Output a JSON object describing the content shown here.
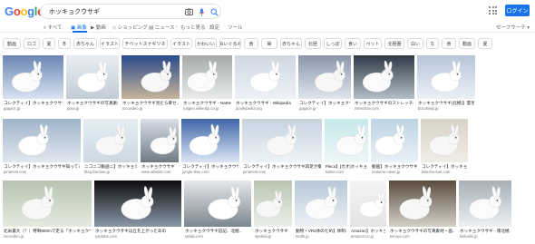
{
  "logo": {
    "text": "Google",
    "colors": [
      "#4285F4",
      "#EA4335",
      "#FBBC05",
      "#4285F4",
      "#34A853",
      "#EA4335"
    ]
  },
  "search": {
    "value": "ホッキョクウサギ"
  },
  "header": {
    "login_label": "ログイン"
  },
  "tabs": [
    {
      "label": "すべて",
      "icon": "search-icon"
    },
    {
      "label": "画像",
      "icon": "image-icon",
      "active": true
    },
    {
      "label": "動画",
      "icon": "video-icon"
    },
    {
      "label": "ショッピング",
      "icon": "shopping-icon"
    },
    {
      "label": "ニュース",
      "icon": "news-icon"
    },
    {
      "label": "もっと見る",
      "icon": "more-icon"
    },
    {
      "label": "設定",
      "icon": ""
    },
    {
      "label": "ツール",
      "icon": ""
    }
  ],
  "safesearch": {
    "label": "セーフサーチ ▾"
  },
  "chips": [
    "動画",
    "ロゴ",
    "夏",
    "冬",
    "赤ちゃん",
    "イラスト",
    "チベットスナギツネ",
    "イラスト",
    "かわいい",
    "ぬいぐるみ",
    "食",
    "巣",
    "赤ちゃん",
    "北極",
    "しっぽ",
    "食い",
    "ペット",
    "北極圏",
    "白い",
    "な",
    "食",
    "動画",
    "夏"
  ],
  "rows": [
    [
      {
        "caption": "コレクティイ】ホッキョクウサギ知ってる",
        "source": "gagace.jp"
      },
      {
        "caption": "ホッキョクウサギの写真素材・画",
        "source": "pixta.jp"
      },
      {
        "caption": "ホッキョクウサギ見たら幸せ..",
        "source": "nicovideo.jp"
      },
      {
        "caption": "ホッキョクウサギ - NatHeg..",
        "source": "natgeo.nikkeibp.co.jp"
      },
      {
        "caption": "ホッキョクウサギ - Wikipedia",
        "source": "ja.wikipedia.org"
      },
      {
        "caption": "コレクティイ】ホッキョクウサギ..",
        "source": "gagace.jp"
      },
      {
        "caption": "ホッキョクウサギのストレッチ、うさぎ最高",
        "source": "mimichan.com"
      },
      {
        "caption": "ホッキョクウサギ(北極)】夏毛に大人の..",
        "source": "bucchiwiji.jp"
      }
    ],
    [
      {
        "caption": "コレクティイ】ホッキョクウサギ知ってる",
        "source": "pinterest.com"
      },
      {
        "caption": "ニコニコ動画ニ】ホッキョクウサギ",
        "source": "blog.livedoor.jp"
      },
      {
        "caption": "ホッキョクウサギ",
        "source": "www.tabelist.com"
      },
      {
        "caption": "コレクティイ】ホッキョクウサギ",
        "source": "jungle-time.com"
      },
      {
        "caption": "コレクティイ】ホッキョクウサギ四足が撮す",
        "source": "pinterest.com"
      },
      {
        "caption": "Pikca】[ガオ]ホッキョクウサギ..",
        "source": "twitter.com"
      },
      {
        "caption": "動画】ホッキョクウサギの美しさ..",
        "source": "matome.naver.jp"
      },
      {
        "caption": "コレクティイ】ホッキョクウサギ..",
        "source": "kisecho-kuri.com"
      }
    ],
    [
      {
        "caption": "北米最大（？）特徴800mで走る「ホッキョクウサギ」",
        "source": "nicovideo.jp"
      },
      {
        "caption": "ホッキョクウサギは丘を上がったあの",
        "source": "youtube.com"
      },
      {
        "caption": "ホッキョクウサギ追記、北極..",
        "source": "tabaly.com"
      },
      {
        "caption": "ホッキョクウサギ　に関して、「北極..",
        "source": "spotrail.jp"
      },
      {
        "caption": "動物・VR2体のため】体制ホッキョク..",
        "source": "tsutfn.jp"
      },
      {
        "caption": "Amazon】ホッキョクウサギ",
        "source": "amazon.co.jp"
      },
      {
        "caption": "ホッキョクウサギの写真素材・画..",
        "source": "kenrya.com"
      },
      {
        "caption": "ホッキョクウサギ - 南北極..",
        "source": "kinkashi.jp"
      },
      {
        "caption": "動物・VR2体のため】ホッキョク..",
        "source": "gagace.jp"
      }
    ]
  ]
}
